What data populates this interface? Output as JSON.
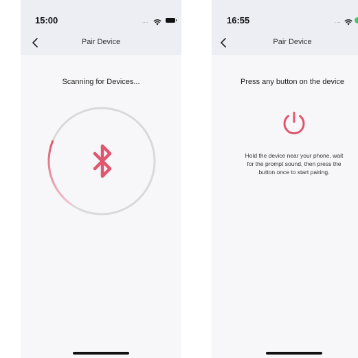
{
  "colors": {
    "accent": "#e0566f",
    "ring_track": "#d9d9d9",
    "header_bg": "#eceef4",
    "screen_bg": "#f7f7f9"
  },
  "screen_scanning": {
    "status_bar": {
      "time": "15:00",
      "signal": "....",
      "icons": [
        "wifi-icon",
        "battery-icon"
      ]
    },
    "nav": {
      "back_icon": "chevron-left-icon",
      "title": "Pair Device"
    },
    "heading": "Scanning for Devices...",
    "center_icon": "bluetooth-icon",
    "progress_ring_fraction": 0.25
  },
  "screen_press_button": {
    "status_bar": {
      "time": "16:55",
      "signal": "....",
      "icons": [
        "wifi-icon",
        "battery-icon"
      ]
    },
    "nav": {
      "back_icon": "chevron-left-icon",
      "title": "Pair Device"
    },
    "heading": "Press any button on the device",
    "center_icon": "power-icon",
    "description_lines": [
      "Hold the device near your phone, wait",
      "for the prompt sound, then press the",
      "button once to start pairing."
    ]
  }
}
